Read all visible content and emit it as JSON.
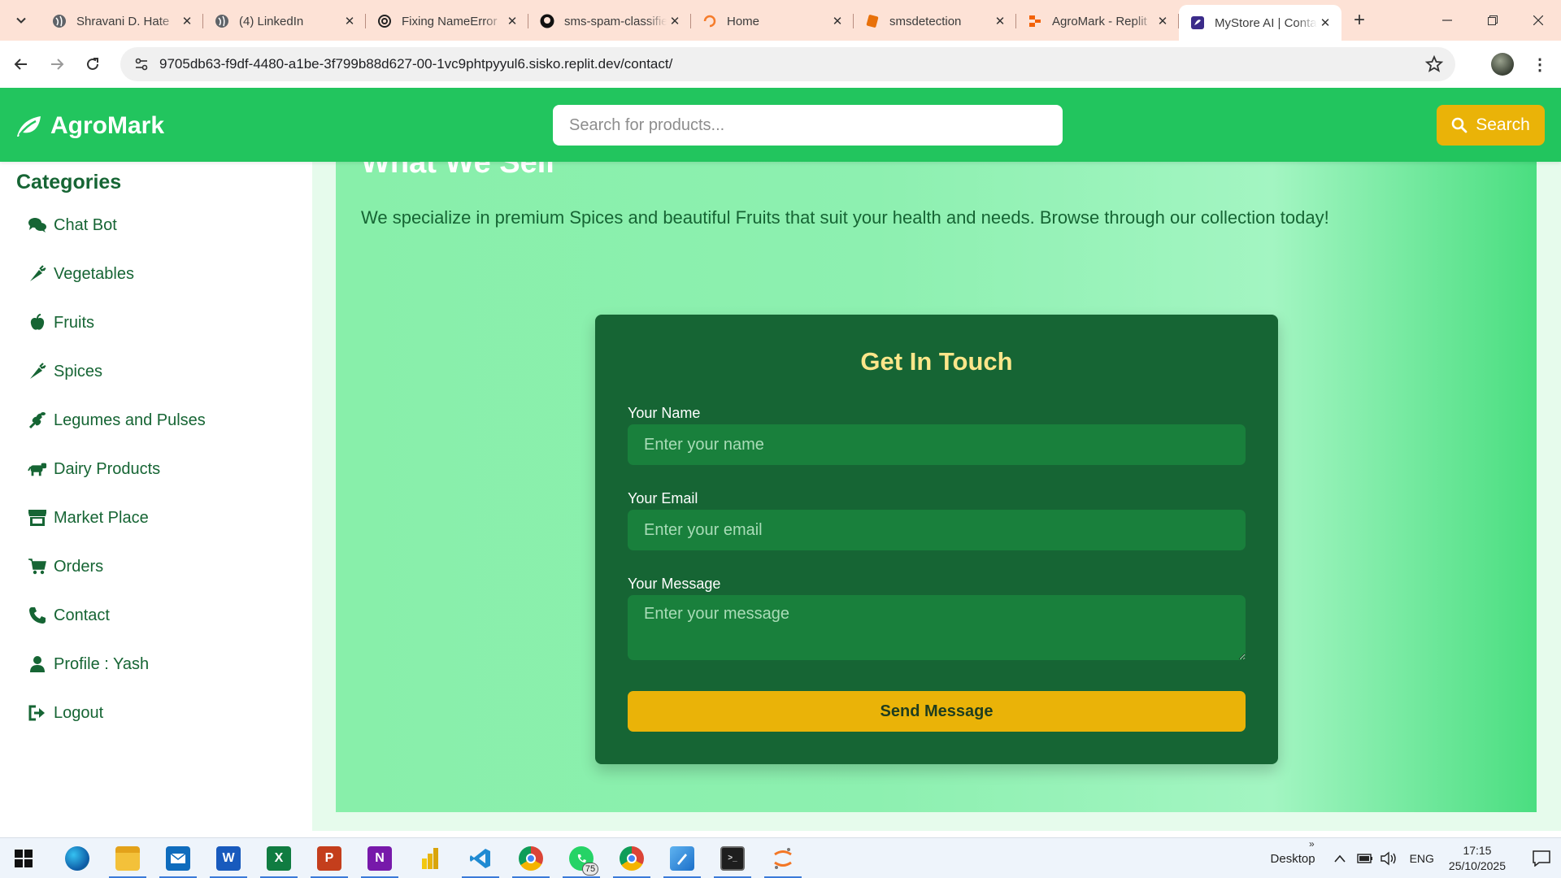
{
  "browser": {
    "tabs": [
      {
        "title": "Shravani D. Hate",
        "icon": "globe-icon",
        "active": false
      },
      {
        "title": "(4) LinkedIn",
        "icon": "globe-icon",
        "active": false
      },
      {
        "title": "Fixing NameError",
        "icon": "openai-icon",
        "active": false
      },
      {
        "title": "sms-spam-classifier",
        "icon": "github-icon",
        "active": false
      },
      {
        "title": "Home",
        "icon": "loading-icon",
        "active": false
      },
      {
        "title": "smsdetection",
        "icon": "notebook-icon",
        "active": false
      },
      {
        "title": "AgroMark - Replit",
        "icon": "replit-icon",
        "active": false
      },
      {
        "title": "MyStore AI | Contact",
        "icon": "store-icon",
        "active": true
      }
    ],
    "url": "9705db63-f9df-4480-a1be-3f799b88d627-00-1vc9phtpyyul6.sisko.replit.dev/contact/"
  },
  "site": {
    "brand": "AgroMark",
    "search_placeholder": "Search for products...",
    "search_button": "Search",
    "colors": {
      "header": "#22c55e",
      "accent": "#eab308",
      "dark_green": "#166534",
      "title_yellow": "#fde68a"
    }
  },
  "sidebar": {
    "title": "Categories",
    "items": [
      {
        "label": "Chat Bot",
        "icon": "comments-icon"
      },
      {
        "label": "Vegetables",
        "icon": "carrot-icon"
      },
      {
        "label": "Fruits",
        "icon": "apple-icon"
      },
      {
        "label": "Spices",
        "icon": "pepper-icon"
      },
      {
        "label": "Legumes and Pulses",
        "icon": "seedling-icon"
      },
      {
        "label": "Dairy Products",
        "icon": "cow-icon"
      },
      {
        "label": "Market Place",
        "icon": "store-icon"
      },
      {
        "label": "Orders",
        "icon": "cart-icon"
      },
      {
        "label": "Contact",
        "icon": "phone-icon"
      },
      {
        "label": "Profile : Yash",
        "icon": "user-icon"
      },
      {
        "label": "Logout",
        "icon": "logout-icon"
      }
    ]
  },
  "main": {
    "section_heading": "What We Sell",
    "section_text": "We specialize in premium Spices and beautiful Fruits that suit your health and needs. Browse through our collection today!"
  },
  "contact": {
    "title": "Get In Touch",
    "name_label": "Your Name",
    "name_placeholder": "Enter your name",
    "email_label": "Your Email",
    "email_placeholder": "Enter your email",
    "message_label": "Your Message",
    "message_placeholder": "Enter your message",
    "submit_label": "Send Message"
  },
  "taskbar": {
    "apps": [
      {
        "name": "edge",
        "running": false
      },
      {
        "name": "file-explorer",
        "running": true
      },
      {
        "name": "mail",
        "running": true
      },
      {
        "name": "word",
        "running": true
      },
      {
        "name": "excel",
        "running": true
      },
      {
        "name": "powerpoint",
        "running": true
      },
      {
        "name": "onenote",
        "running": true
      },
      {
        "name": "power-bi",
        "running": false
      },
      {
        "name": "vscode",
        "running": true
      },
      {
        "name": "chrome-profile",
        "running": true
      },
      {
        "name": "whatsapp",
        "running": true,
        "badge": "75"
      },
      {
        "name": "chrome",
        "running": true
      },
      {
        "name": "paint",
        "running": true
      },
      {
        "name": "terminal",
        "running": true
      },
      {
        "name": "jupyter",
        "running": true
      }
    ],
    "desktop_label": "Desktop",
    "language": "ENG",
    "time": "17:15",
    "date": "25/10/2025"
  }
}
